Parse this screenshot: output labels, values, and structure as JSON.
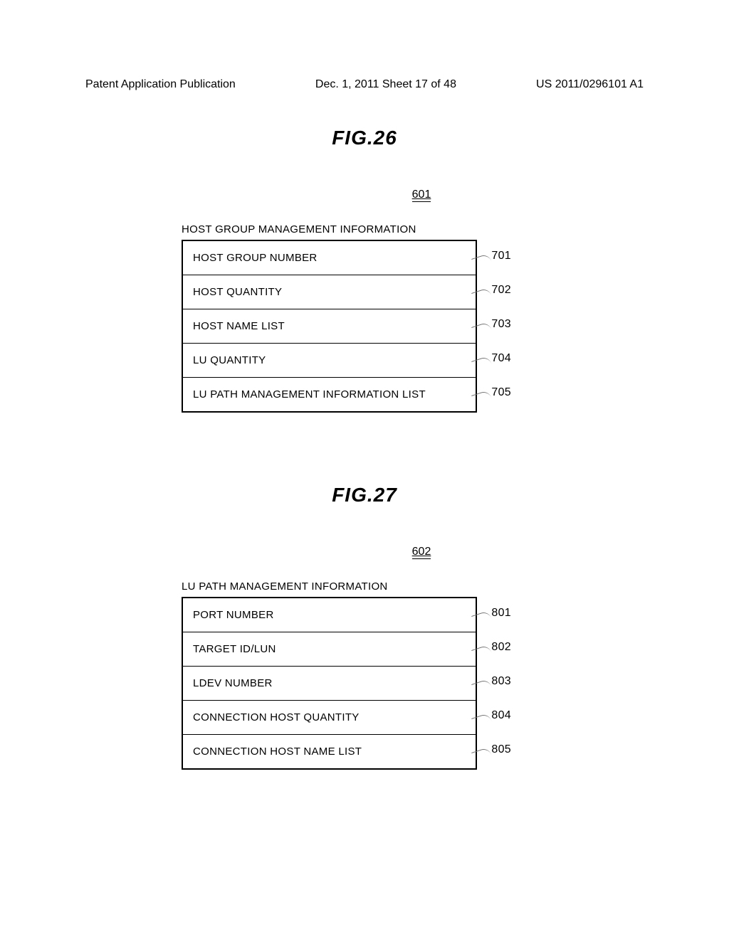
{
  "header": {
    "left": "Patent Application Publication",
    "center": "Dec. 1, 2011  Sheet 17 of 48",
    "right": "US 2011/0296101 A1"
  },
  "fig26": {
    "title": "FIG.26",
    "ref": "601",
    "caption": "HOST GROUP MANAGEMENT INFORMATION",
    "rows": [
      {
        "label": "HOST GROUP NUMBER",
        "ref": "701"
      },
      {
        "label": "HOST QUANTITY",
        "ref": "702"
      },
      {
        "label": "HOST NAME LIST",
        "ref": "703"
      },
      {
        "label": "LU QUANTITY",
        "ref": "704"
      },
      {
        "label": "LU PATH MANAGEMENT INFORMATION LIST",
        "ref": "705"
      }
    ]
  },
  "fig27": {
    "title": "FIG.27",
    "ref": "602",
    "caption": "LU PATH MANAGEMENT INFORMATION",
    "rows": [
      {
        "label": "PORT NUMBER",
        "ref": "801"
      },
      {
        "label": "TARGET ID/LUN",
        "ref": "802"
      },
      {
        "label": "LDEV NUMBER",
        "ref": "803"
      },
      {
        "label": "CONNECTION HOST QUANTITY",
        "ref": "804"
      },
      {
        "label": "CONNECTION HOST NAME LIST",
        "ref": "805"
      }
    ]
  }
}
